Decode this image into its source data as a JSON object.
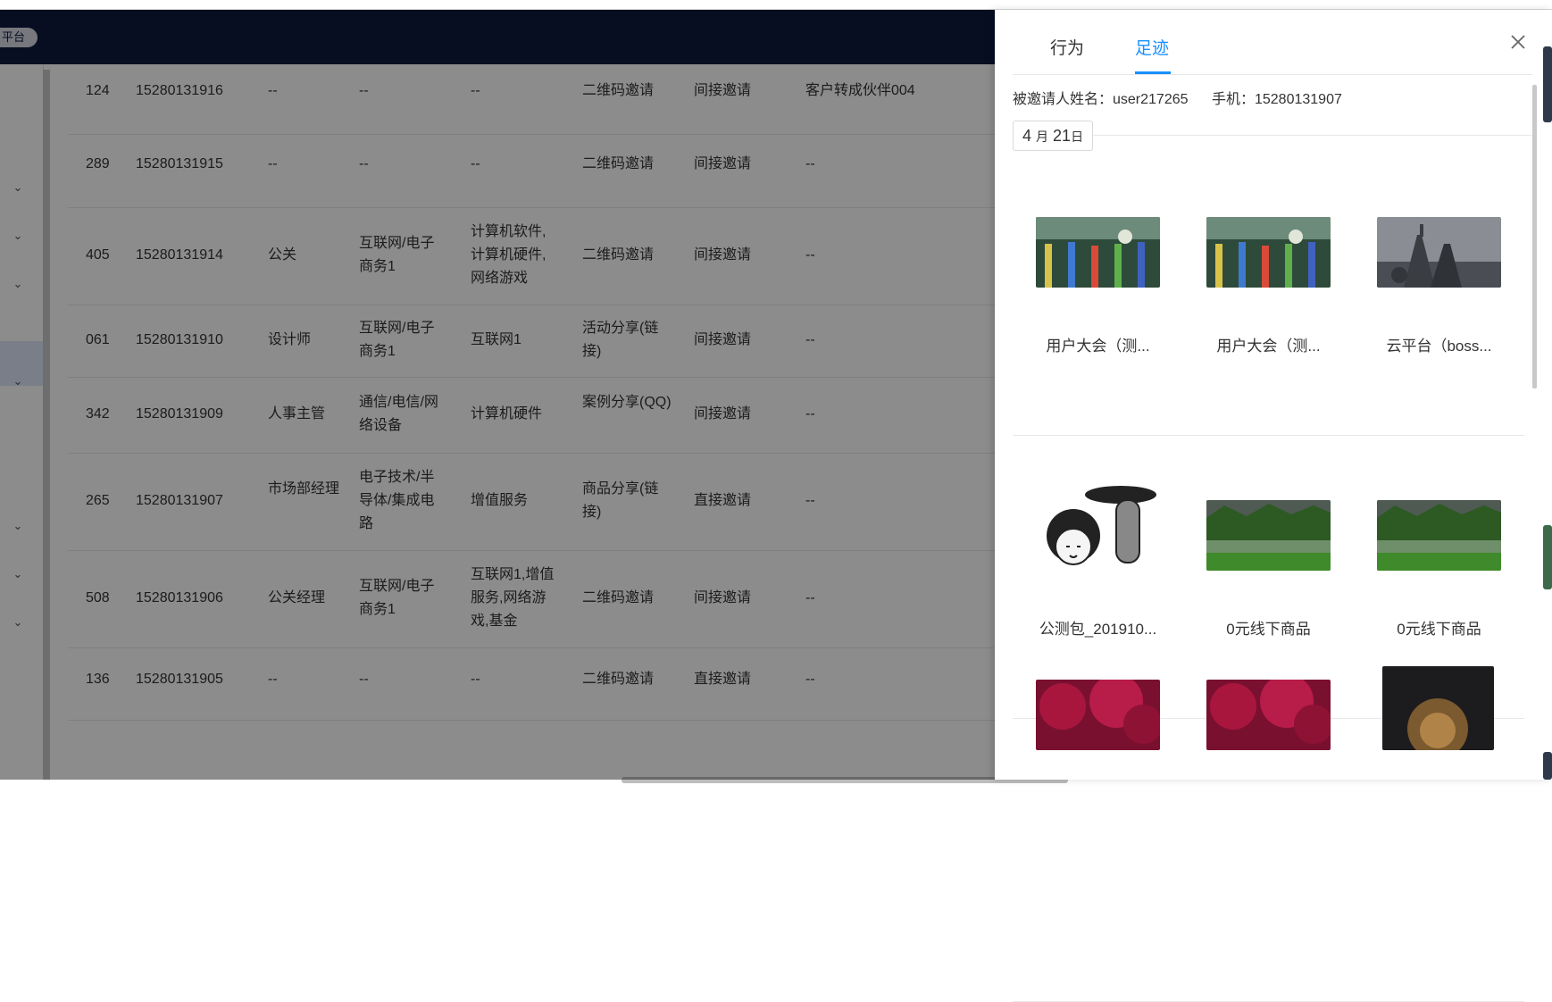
{
  "header": {
    "platform_tag": "平台"
  },
  "table": {
    "rows": [
      {
        "id": "124",
        "phone": "15280131916",
        "position": "--",
        "industry": "--",
        "interests": "--",
        "channel": "二维码邀请",
        "type": "间接邀请",
        "partner": "客户转成伙伴004"
      },
      {
        "id": "289",
        "phone": "15280131915",
        "position": "--",
        "industry": "--",
        "interests": "--",
        "channel": "二维码邀请",
        "type": "间接邀请",
        "partner": "--"
      },
      {
        "id": "405",
        "phone": "15280131914",
        "position": "公关",
        "industry": "互联网/电子商务1",
        "interests": "计算机软件,计算机硬件,网络游戏",
        "channel": "二维码邀请",
        "type": "间接邀请",
        "partner": "--"
      },
      {
        "id": "061",
        "phone": "15280131910",
        "position": "设计师",
        "industry": "互联网/电子商务1",
        "interests": "互联网1",
        "channel": "活动分享(链接)",
        "type": "间接邀请",
        "partner": "--"
      },
      {
        "id": "342",
        "phone": "15280131909",
        "position": "人事主管",
        "industry": "通信/电信/网络设备",
        "interests": "计算机硬件",
        "channel": "案例分享(QQ)",
        "type": "间接邀请",
        "partner": "--"
      },
      {
        "id": "265",
        "phone": "15280131907",
        "position": "市场部经理",
        "industry": "电子技术/半导体/集成电路",
        "interests": "增值服务",
        "channel": "商品分享(链接)",
        "type": "直接邀请",
        "partner": "--"
      },
      {
        "id": "508",
        "phone": "15280131906",
        "position": "公关经理",
        "industry": "互联网/电子商务1",
        "interests": "互联网1,增值服务,网络游戏,基金",
        "channel": "二维码邀请",
        "type": "间接邀请",
        "partner": "--"
      },
      {
        "id": "136",
        "phone": "15280131905",
        "position": "--",
        "industry": "--",
        "interests": "--",
        "channel": "二维码邀请",
        "type": "直接邀请",
        "partner": "--"
      }
    ]
  },
  "drawer": {
    "tabs": [
      {
        "label": "行为"
      },
      {
        "label": "足迹"
      }
    ],
    "active_tab": "足迹",
    "info": {
      "name_label": "被邀请人姓名：user217265",
      "phone_label": "手机：15280131907"
    },
    "date": {
      "month": "4",
      "month_unit": "月",
      "day": "21",
      "day_unit": "日"
    },
    "items": [
      {
        "caption": "用户大会（测...",
        "thumb": "game-scene-image"
      },
      {
        "caption": "用户大会（测...",
        "thumb": "game-scene-image"
      },
      {
        "caption": "云平台（boss...",
        "thumb": "castle-image"
      },
      {
        "caption": "公测包_201910...",
        "thumb": "meme-image"
      },
      {
        "caption": "0元线下商品",
        "thumb": "lake-forest-image"
      },
      {
        "caption": "0元线下商品",
        "thumb": "lake-forest-image"
      },
      {
        "caption": "",
        "thumb": "red-trees-image"
      },
      {
        "caption": "",
        "thumb": "red-trees-image"
      },
      {
        "caption": "",
        "thumb": "lion-image"
      }
    ]
  },
  "colors": {
    "header_bg": "#0d1b3e",
    "accent": "#1890ff"
  }
}
